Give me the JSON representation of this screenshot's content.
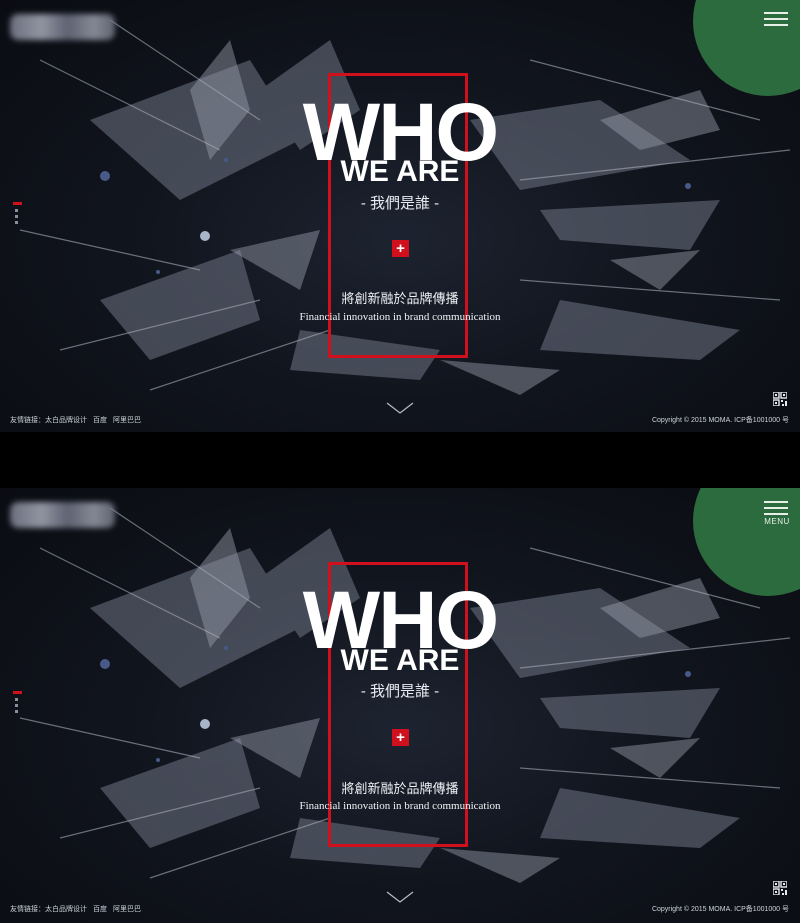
{
  "hero": {
    "title": "WHO",
    "subtitle": "WE ARE",
    "zh_title": "- 我們是誰 -",
    "plus": "+",
    "slogan_zh": "將創新融於品牌傳播",
    "slogan_en": "Financial innovation in brand communication"
  },
  "menu": {
    "label": "MENU"
  },
  "footer": {
    "links_label": "友情链接：",
    "links": [
      "太白品牌设计",
      "百度",
      "阿里巴巴"
    ],
    "copyright": "Copyright © 2015 MOMA.  ICP备1001000 号"
  },
  "colors": {
    "accent": "#d0101c",
    "menu_circle": "#2c6b3d",
    "background": "#11151e"
  },
  "icons": [
    "hamburger-icon",
    "chevron-down-icon",
    "qr-code-icon"
  ]
}
